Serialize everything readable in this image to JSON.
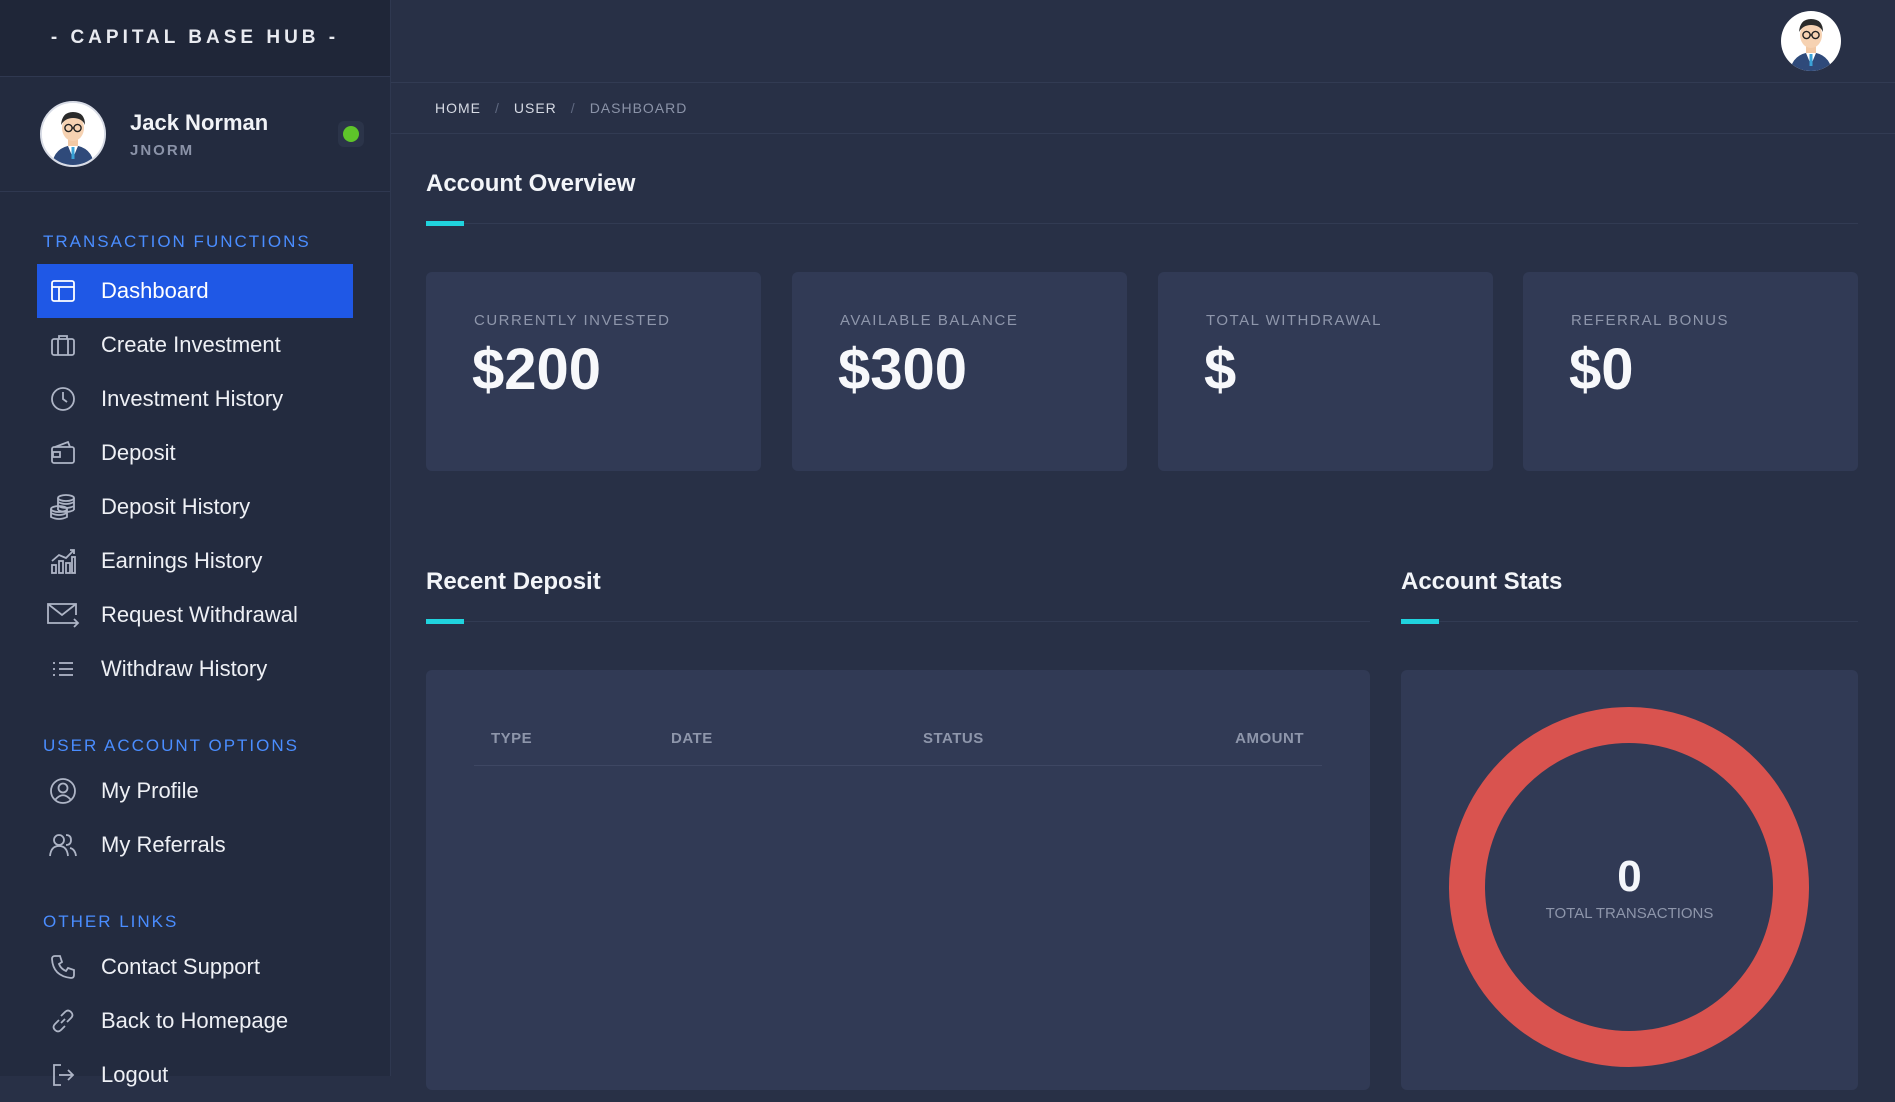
{
  "brand": "- CAPITAL BASE HUB -",
  "user": {
    "name": "Jack Norman",
    "username": "JNORM",
    "status_color": "#5ec42a"
  },
  "sidebar": {
    "sections": [
      {
        "title": "TRANSACTION FUNCTIONS"
      },
      {
        "title": "USER ACCOUNT OPTIONS"
      },
      {
        "title": "OTHER LINKS"
      }
    ],
    "items": [
      {
        "label": "Dashboard",
        "icon": "dashboard-icon",
        "active": true
      },
      {
        "label": "Create Investment",
        "icon": "briefcase-icon"
      },
      {
        "label": "Investment History",
        "icon": "clock-icon"
      },
      {
        "label": "Deposit",
        "icon": "wallet-icon"
      },
      {
        "label": "Deposit History",
        "icon": "coins-icon"
      },
      {
        "label": "Earnings History",
        "icon": "bar-chart-icon"
      },
      {
        "label": "Request Withdrawal",
        "icon": "mail-arrow-icon"
      },
      {
        "label": "Withdraw History",
        "icon": "list-icon"
      },
      {
        "label": "My Profile",
        "icon": "user-circle-icon"
      },
      {
        "label": "My Referrals",
        "icon": "users-icon"
      },
      {
        "label": "Contact Support",
        "icon": "phone-icon"
      },
      {
        "label": "Back to Homepage",
        "icon": "link-icon"
      },
      {
        "label": "Logout",
        "icon": "logout-icon"
      }
    ]
  },
  "breadcrumb": [
    "HOME",
    "USER",
    "DASHBOARD"
  ],
  "overview": {
    "title": "Account Overview",
    "cards": [
      {
        "label": "CURRENTLY INVESTED",
        "value": "$200"
      },
      {
        "label": "AVAILABLE BALANCE",
        "value": "$300"
      },
      {
        "label": "TOTAL WITHDRAWAL",
        "value": "$"
      },
      {
        "label": "REFERRAL BONUS",
        "value": "$0"
      }
    ]
  },
  "recent_deposit": {
    "title": "Recent Deposit",
    "columns": [
      "TYPE",
      "DATE",
      "STATUS",
      "AMOUNT"
    ]
  },
  "account_stats": {
    "title": "Account Stats",
    "total": "0",
    "total_label": "TOTAL TRANSACTIONS",
    "ring_color": "#d9534f"
  },
  "colors": {
    "accent": "#20d3de",
    "active_nav": "#1f58e6",
    "section_title": "#4a8dff"
  }
}
